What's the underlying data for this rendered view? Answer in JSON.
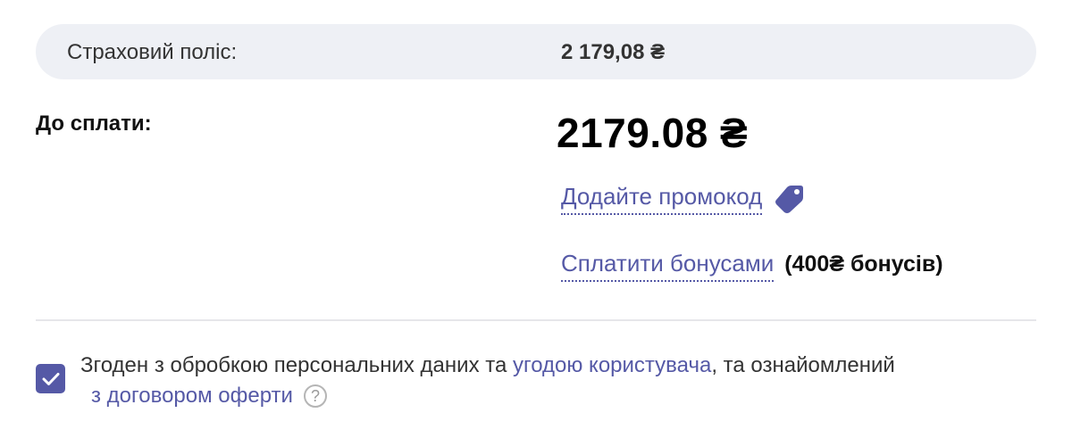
{
  "summary": {
    "policy_label": "Страховий поліс:",
    "policy_value": "2 179,08 ₴",
    "due_label": "До сплати:",
    "due_amount": "2179.08 ₴"
  },
  "actions": {
    "promo_link": "Додайте промокод",
    "promo_icon": "tag-icon",
    "bonus_link": "Сплатити бонусами",
    "bonus_note": "(400₴ бонусів)"
  },
  "consent": {
    "checked": true,
    "text_before": "Згоден з обробкою персональних даних та ",
    "user_agreement_link": "угодою користувача",
    "text_after": ", та ознайомлений",
    "offer_link": "з договором оферти",
    "help_icon_glyph": "?"
  },
  "colors": {
    "accent": "#5559a6",
    "summary_background": "#eef0f5",
    "divider": "#e6e6ea"
  }
}
